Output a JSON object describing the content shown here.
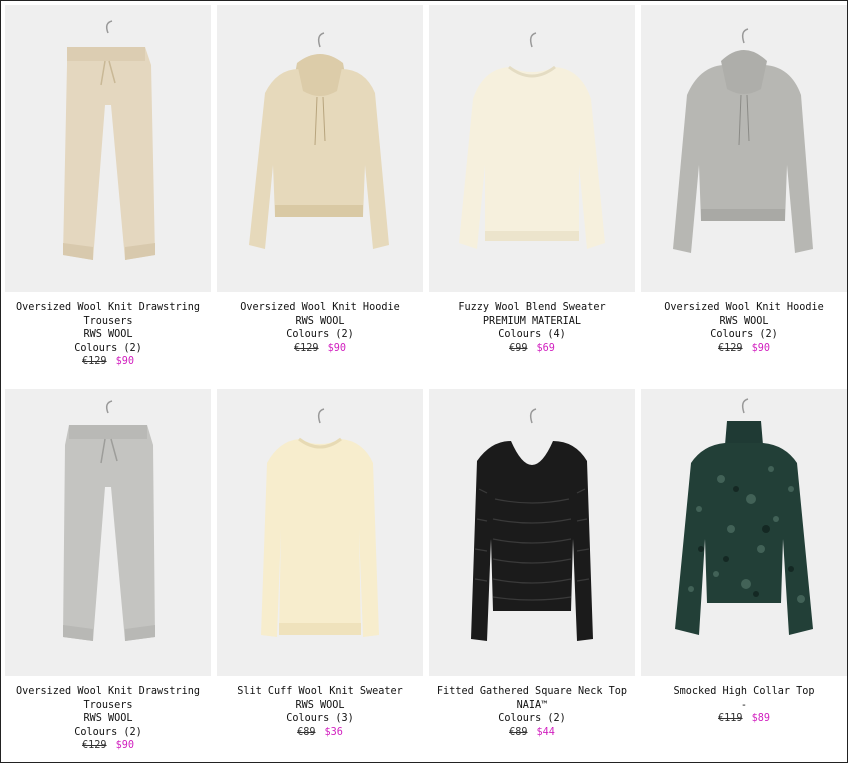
{
  "products": [
    {
      "name": "Oversized Wool Knit Drawstring Trousers",
      "material": "RWS WOOL",
      "colours": "Colours (2)",
      "price_original": "€129",
      "price_sale": "$90"
    },
    {
      "name": "Oversized Wool Knit Hoodie",
      "material": "RWS WOOL",
      "colours": "Colours (2)",
      "price_original": "€129",
      "price_sale": "$90"
    },
    {
      "name": "Fuzzy Wool Blend Sweater",
      "material": "PREMIUM MATERIAL",
      "colours": "Colours (4)",
      "price_original": "€99",
      "price_sale": "$69"
    },
    {
      "name": "Oversized Wool Knit Hoodie",
      "material": "RWS WOOL",
      "colours": "Colours (2)",
      "price_original": "€129",
      "price_sale": "$90"
    },
    {
      "name": "Oversized Wool Knit Drawstring Trousers",
      "material": "RWS WOOL",
      "colours": "Colours (2)",
      "price_original": "€129",
      "price_sale": "$90"
    },
    {
      "name": "Slit Cuff Wool Knit Sweater",
      "material": "RWS WOOL",
      "colours": "Colours (3)",
      "price_original": "€89",
      "price_sale": "$36"
    },
    {
      "name": "Fitted Gathered Square Neck Top",
      "material": "NAIA™",
      "colours": "Colours (2)",
      "price_original": "€89",
      "price_sale": "$44"
    },
    {
      "name": "Smocked High Collar Top",
      "material": "-",
      "colours": "",
      "price_original": "€119",
      "price_sale": "$89"
    }
  ],
  "colors": {
    "sale_price": "#d11fbf",
    "photo_background": "#efefef"
  }
}
